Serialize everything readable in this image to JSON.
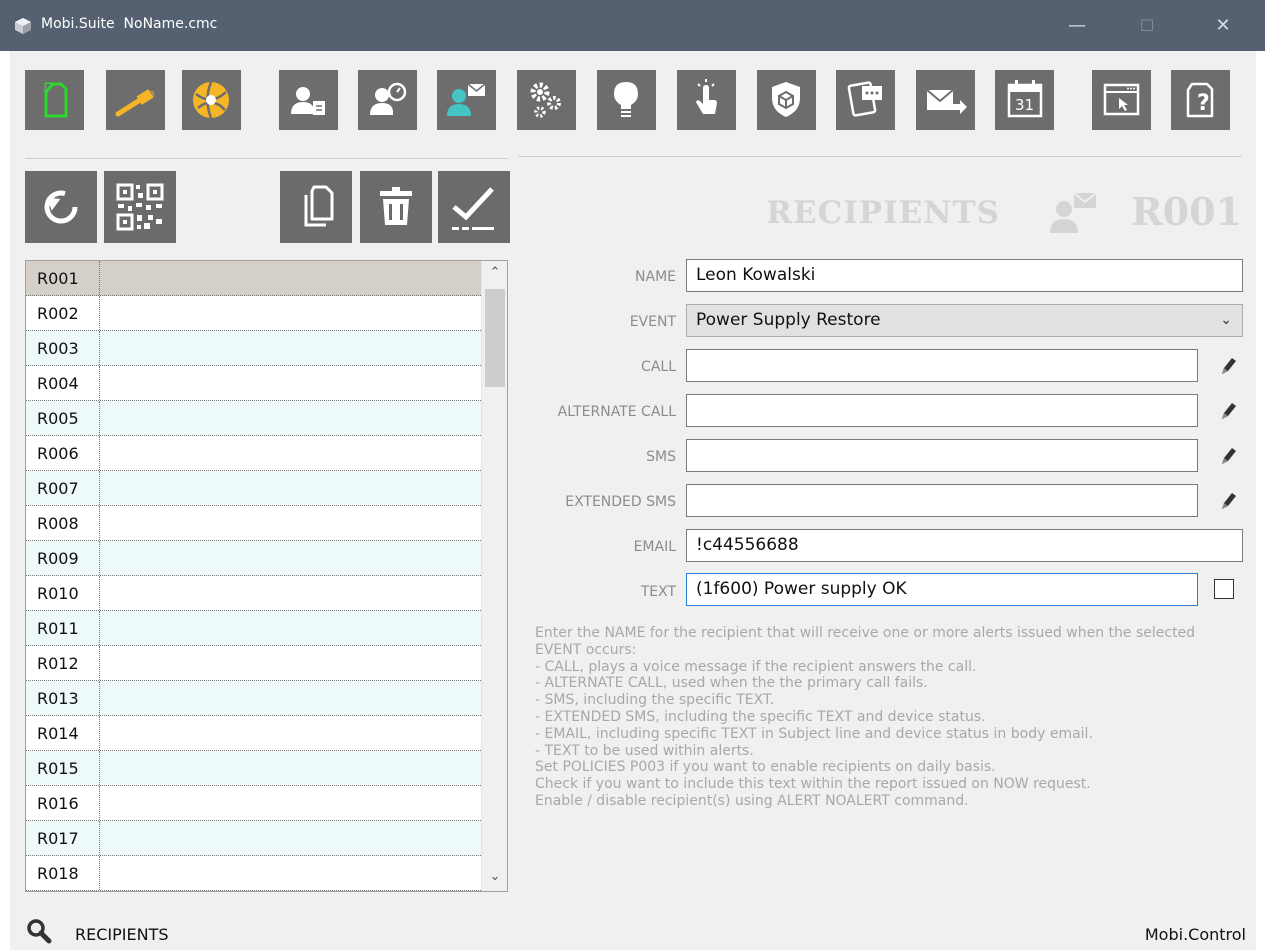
{
  "window": {
    "app_name": "Mobi.Suite",
    "file_name": "NoName.cmc",
    "minimize": "—",
    "maximize": "☐",
    "close": "✕"
  },
  "toolbar": {
    "buttons": [
      {
        "icon": "new-file-icon"
      },
      {
        "icon": "usb-connect-icon"
      },
      {
        "icon": "network-icon"
      },
      {
        "icon": "user-report-icon"
      },
      {
        "icon": "user-settings-icon"
      },
      {
        "icon": "recipients-icon"
      },
      {
        "icon": "settings-icon"
      },
      {
        "icon": "lightbulb-icon"
      },
      {
        "icon": "touch-icon"
      },
      {
        "icon": "shield-icon"
      },
      {
        "icon": "remote-messages-icon"
      },
      {
        "icon": "send-email-icon"
      },
      {
        "icon": "calendar-icon",
        "label": "31"
      },
      {
        "icon": "window-cursor-icon"
      },
      {
        "icon": "help-icon"
      }
    ]
  },
  "action_buttons": [
    {
      "icon": "refresh-icon"
    },
    {
      "icon": "qr-code-icon"
    },
    {
      "icon": "copy-icon"
    },
    {
      "icon": "delete-icon"
    },
    {
      "icon": "check-icon"
    }
  ],
  "header": {
    "label": "RECIPIENTS",
    "code": "R001"
  },
  "list": {
    "selected": "R001",
    "rows": [
      "R001",
      "R002",
      "R003",
      "R004",
      "R005",
      "R006",
      "R007",
      "R008",
      "R009",
      "R010",
      "R011",
      "R012",
      "R013",
      "R014",
      "R015",
      "R016",
      "R017",
      "R018"
    ]
  },
  "form": {
    "name_label": "NAME",
    "name_value": "Leon Kowalski",
    "event_label": "EVENT",
    "event_value": "Power Supply Restore",
    "call_label": "CALL",
    "call_value": "",
    "alt_call_label": "ALTERNATE CALL",
    "alt_call_value": "",
    "sms_label": "SMS",
    "sms_value": "",
    "ext_sms_label": "EXTENDED SMS",
    "ext_sms_value": "",
    "email_label": "EMAIL",
    "email_value": "!c44556688",
    "text_label": "TEXT",
    "text_value": "(1f600) Power supply OK",
    "text_checked": false
  },
  "help_lines": [
    "Enter the NAME for the recipient that will receive one or more alerts issued when the selected EVENT occurs:",
    "- CALL, plays a voice message if the recipient answers the call.",
    "- ALTERNATE CALL, used when the the primary call fails.",
    "- SMS, including the specific TEXT.",
    "- EXTENDED SMS, including the specific TEXT and device status.",
    "- EMAIL, including specific TEXT in Subject line and device status in body email.",
    "- TEXT to be used within alerts.",
    "Set POLICIES P003 if you want to enable recipients on daily basis.",
    "Check if you want to include this text within the report issued on NOW request.",
    "Enable / disable recipient(s) using ALERT NOALERT command."
  ],
  "status": {
    "left": "RECIPIENTS",
    "right": "Mobi.Control"
  },
  "colors": {
    "titlebar": "#556070",
    "button": "#6d6d6d",
    "selected_row": "#d4cfc8",
    "alt_row": "#eef9f9",
    "accent_green": "#2bd82b",
    "accent_teal": "#45c4c4",
    "accent_gold": "#f5b526"
  }
}
